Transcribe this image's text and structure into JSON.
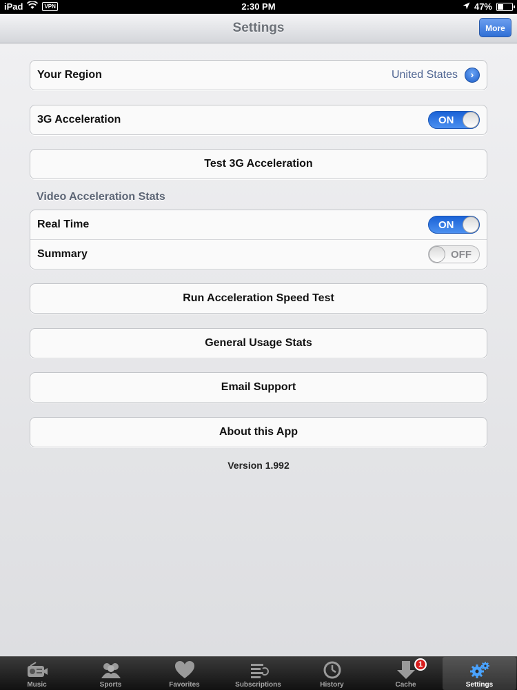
{
  "status_bar": {
    "device": "iPad",
    "vpn": "VPN",
    "time": "2:30 PM",
    "battery": "47%",
    "battery_level": 0.47
  },
  "nav": {
    "title": "Settings",
    "more_label": "More"
  },
  "region": {
    "label": "Your Region",
    "value": "United States"
  },
  "acceleration": {
    "label": "3G Acceleration",
    "toggle_on": "ON"
  },
  "test_button": "Test 3G Acceleration",
  "video_stats": {
    "header": "Video Acceleration Stats",
    "real_time_label": "Real Time",
    "real_time_state": "ON",
    "summary_label": "Summary",
    "summary_state": "OFF"
  },
  "buttons": {
    "speed_test": "Run Acceleration Speed Test",
    "usage_stats": "General Usage Stats",
    "email_support": "Email Support",
    "about": "About this App"
  },
  "version": "Version 1.992",
  "tabs": [
    {
      "label": "Music",
      "icon": "radio-icon"
    },
    {
      "label": "Sports",
      "icon": "people-icon"
    },
    {
      "label": "Favorites",
      "icon": "heart-icon"
    },
    {
      "label": "Subscriptions",
      "icon": "list-icon"
    },
    {
      "label": "History",
      "icon": "clock-icon"
    },
    {
      "label": "Cache",
      "icon": "download-icon",
      "badge": "1"
    },
    {
      "label": "Settings",
      "icon": "gears-icon",
      "selected": true
    }
  ],
  "colors": {
    "accent_blue": "#2f6fd6",
    "toggle_on": "#1a62d6",
    "badge_red": "#d81e1e"
  }
}
